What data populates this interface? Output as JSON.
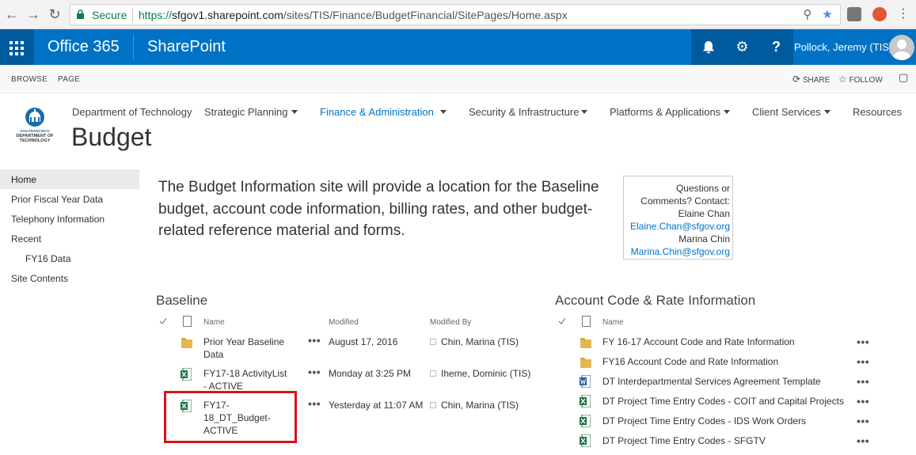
{
  "browser": {
    "secure_label": "Secure",
    "url_scheme": "https://",
    "url_host": "sfgov1.sharepoint.com",
    "url_path": "/sites/TIS/Finance/BudgetFinancial/SitePages/Home.aspx"
  },
  "suite_bar": {
    "app_launcher_icon": "waffle-icon",
    "brand": "Office 365",
    "app_name": "SharePoint",
    "user_name": "Pollock, Jeremy (TIS)",
    "accent": "#0072c6"
  },
  "ribbon": {
    "tabs": [
      "BROWSE",
      "PAGE"
    ],
    "share_label": "SHARE",
    "follow_label": "FOLLOW"
  },
  "logo": {
    "text_line1": "SAN FRANCISCO",
    "text_line2": "DEPARTMENT OF",
    "text_line3": "TECHNOLOGY"
  },
  "top_nav": [
    {
      "label": "Department of Technology",
      "caret": false
    },
    {
      "label": "Strategic Planning",
      "caret": true
    },
    {
      "label": "Finance & Administration",
      "caret": true,
      "active": true
    },
    {
      "label": "Security & Infrastructure",
      "caret": true
    },
    {
      "label": "Platforms & Applications",
      "caret": true
    },
    {
      "label": "Client Services",
      "caret": true
    },
    {
      "label": "Resources",
      "caret": false
    }
  ],
  "site_title": "Budget",
  "left_nav": [
    {
      "label": "Home",
      "selected": true
    },
    {
      "label": "Prior Fiscal Year Data"
    },
    {
      "label": "Telephony Information"
    },
    {
      "label": "Recent"
    },
    {
      "label": "FY16 Data",
      "indent": true
    },
    {
      "label": "Site Contents"
    }
  ],
  "intro_text": "The Budget Information site will provide a location for the Baseline budget, account code information, billing rates, and other budget-related reference material and forms.",
  "contact": {
    "line1": "Questions or",
    "line2": "Comments? Contact:",
    "name1": "Elaine Chan",
    "email1": "Elaine.Chan@sfgov.org",
    "name2": "Marina Chin",
    "email2": "Marina.Chin@sfgov.org"
  },
  "baseline": {
    "title": "Baseline",
    "columns": [
      "Name",
      "Modified",
      "Modified By"
    ],
    "rows": [
      {
        "icon": "folder-icon",
        "name_l1": "Prior Year Baseline",
        "name_l2": "Data",
        "name_l3": "",
        "modified": "August 17, 2016",
        "modified_by": "Chin, Marina (TIS)"
      },
      {
        "icon": "excel-icon",
        "name_l1": "FY17-18 ActivityList",
        "name_l2": "- ACTIVE",
        "name_l3": "",
        "modified": "Monday at 3:25 PM",
        "modified_by": "Iheme, Dominic (TIS)"
      },
      {
        "icon": "excel-icon",
        "name_l1": "FY17-",
        "name_l2": "18_DT_Budget-",
        "name_l3": "ACTIVE",
        "modified": "Yesterday at 11:07 AM",
        "modified_by": "Chin, Marina (TIS)"
      }
    ]
  },
  "account_codes": {
    "title": "Account Code & Rate Information",
    "columns": [
      "Name"
    ],
    "rows": [
      {
        "icon": "folder-icon",
        "name": "FY 16-17 Account Code and Rate Information"
      },
      {
        "icon": "folder-icon",
        "name": "FY16 Account Code and Rate Information"
      },
      {
        "icon": "word-icon",
        "name": "DT Interdepartmental Services Agreement Template"
      },
      {
        "icon": "excel-icon",
        "name": "DT Project Time Entry Codes - COIT and Capital Projects"
      },
      {
        "icon": "excel-icon",
        "name": "DT Project Time Entry Codes - IDS Work Orders"
      },
      {
        "icon": "excel-icon",
        "name": "DT Project Time Entry Codes - SFGTV"
      }
    ]
  },
  "row_menu_glyph": "•••"
}
